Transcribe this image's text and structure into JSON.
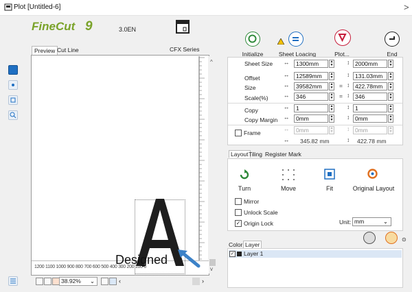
{
  "window": {
    "title": "Plot [Untitled-6]",
    "close_glyph": ">"
  },
  "app": {
    "logo": "FineCut9",
    "version": "3.0EN",
    "device": "CFX Series"
  },
  "preview": {
    "tabs": [
      "Preview",
      "Cut Line"
    ],
    "ruler_bottom": "1200 1100 1000  900  800  700  600  500  400  300  200  100    0",
    "designed_text": "Designed",
    "zoom": "38.92%"
  },
  "toolbar": {
    "initialize": "Initialize",
    "sheet_loading": "Sheet Loacing",
    "plot": "Plot...",
    "end": "End"
  },
  "sheet": {
    "label": "Sheet Size",
    "width": "1300mm",
    "height": "2000mm"
  },
  "offset": {
    "label": "Offset",
    "x": "12589mm",
    "y": "131.03mm"
  },
  "size": {
    "label": "Size",
    "w": "39582mm",
    "h": "422.78mm",
    "eq": "="
  },
  "scale": {
    "label": "Scale(%)",
    "x": "346",
    "y": "346",
    "eq": "="
  },
  "copy": {
    "label": "Copy",
    "x": "1",
    "y": "1"
  },
  "copy_margin": {
    "label": "Copy Margin",
    "x": "0mm",
    "y": "0mm"
  },
  "frame": {
    "label": "Frame",
    "x": "0mm",
    "y": "0mm",
    "total_w": "345.82 mm",
    "total_h": "422.78 mm"
  },
  "panel_tabs": [
    "Layout",
    "Tiling",
    "Register Mark"
  ],
  "layout": {
    "turn": "Turn",
    "move": "Move",
    "fit": "Fit",
    "original": "Original Layout",
    "mirror": "Mirror",
    "unlock_scale": "Unlock Scale",
    "origin_lock": "Origin Lock",
    "unit_label": "Unit:",
    "unit_value": "mm"
  },
  "layers": {
    "tabs": [
      "Color",
      "Layer"
    ],
    "items": [
      "Layer 1"
    ]
  },
  "colors": {
    "accent": "#1f6fc2",
    "logo_green": "#7aa32a",
    "arrow_blue": "#3c82c8"
  }
}
